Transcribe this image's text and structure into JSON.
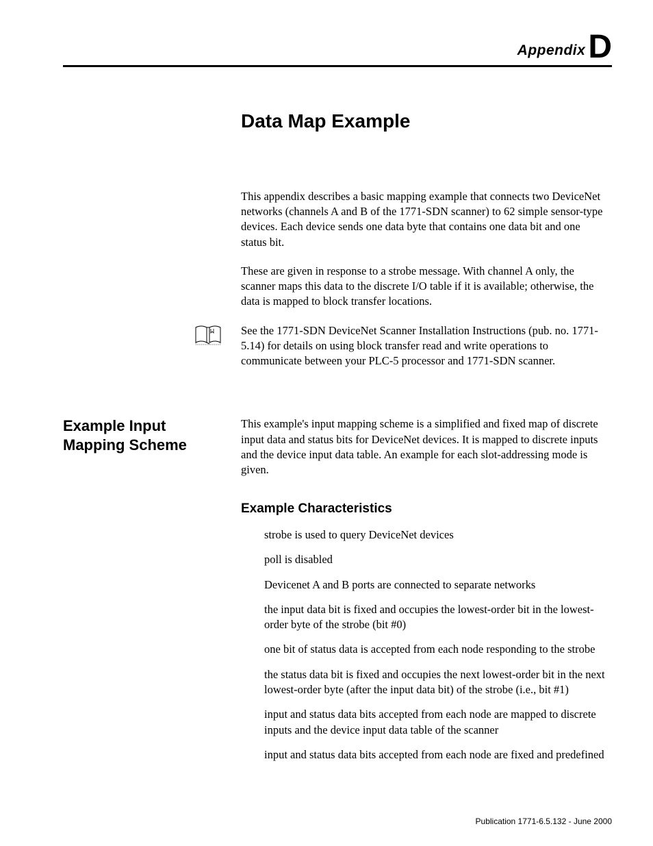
{
  "header": {
    "label_small": "Appendix",
    "label_big": "D"
  },
  "title": "Data Map Example",
  "intro": {
    "p1": "This appendix describes a basic mapping example that connects two DeviceNet networks (channels A and B of the 1771-SDN scanner) to 62 simple sensor-type devices. Each device sends one data byte that contains one data bit and one status bit.",
    "p2": "These are given in response to a strobe message. With channel A only, the scanner maps this data to the discrete I/O table if it is available; otherwise, the data is mapped to block transfer locations.",
    "p3": "See the 1771-SDN DeviceNet Scanner Installation Instructions (pub. no. 1771-5.14) for details on using block transfer read and write operations to communicate between your PLC-5 processor and 1771-SDN scanner."
  },
  "section2": {
    "side_heading": "Example Input Mapping Scheme",
    "p1": "This example's input mapping scheme is a simplified and fixed map of discrete input data and status bits for DeviceNet devices. It is mapped to discrete inputs and the device input data table. An example for each slot-addressing mode is given.",
    "sub_heading": "Example Characteristics",
    "bullets": [
      "strobe is used to query DeviceNet devices",
      "poll is disabled",
      "Devicenet A and B ports are connected to separate networks",
      "the input data bit is fixed and occupies the lowest-order bit in the lowest-order byte of the strobe (bit #0)",
      "one bit of status data is accepted from each node responding to the strobe",
      "the status data bit is fixed and occupies the next lowest-order bit in the next lowest-order byte (after the input data bit) of the strobe (i.e., bit #1)",
      "input and status data bits accepted from each node are mapped to discrete inputs and the device input data table of the scanner",
      "input and status data bits accepted from each node are fixed and predefined"
    ]
  },
  "footer": "Publication 1771-6.5.132 - June 2000"
}
